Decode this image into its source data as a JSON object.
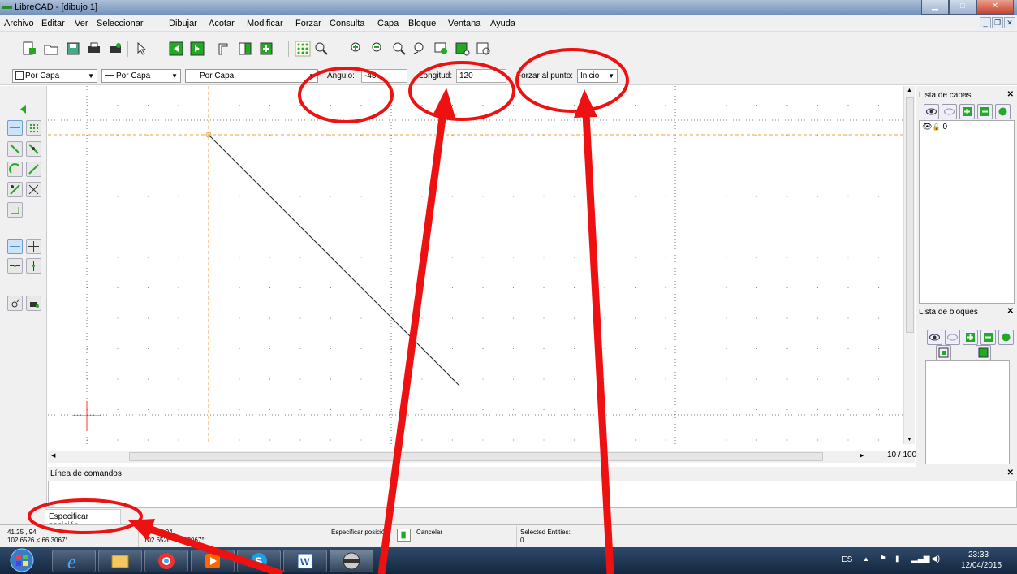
{
  "window": {
    "title": "LibreCAD - [dibujo 1]"
  },
  "menu": [
    "Archivo",
    "Editar",
    "Ver",
    "Seleccionar",
    "Dibujar",
    "Acotar",
    "Modificar",
    "Forzar",
    "Consulta",
    "Capa",
    "Bloque",
    "Ventana",
    "Ayuda"
  ],
  "tool_options": {
    "color_combo": "Por Capa",
    "width_combo": "Por Capa",
    "linetype_combo": "Por Capa",
    "angle_label": "Angulo:",
    "angle_value": "-45",
    "length_label": "Longitud:",
    "length_value": "120",
    "snap_label": "Forzar al punto:",
    "snap_value": "Inicio"
  },
  "canvas": {
    "page_info": "10 / 100"
  },
  "layers_panel": {
    "title": "Lista de capas",
    "layers": [
      {
        "name": "0"
      }
    ]
  },
  "blocks_panel": {
    "title": "Lista de bloques"
  },
  "command_line": {
    "title": "Línea de comandos",
    "tab_label": "Especificar posición"
  },
  "status": {
    "abs_coords": "41.25 , 94",
    "abs_polar": "102.6526 < 66.3067°",
    "rel_coords": "41.25 , 94",
    "rel_polar": "102.6526 < 66.3067°",
    "mouse_left": "Especificar posición",
    "mouse_right": "Cancelar",
    "selected_label": "Selected Entities:",
    "selected_count": "0"
  },
  "taskbar": {
    "language": "ES",
    "time": "23:33",
    "date": "12/04/2015"
  },
  "colors": {
    "grid_guide": "#f0a040",
    "annotation": "#ee1111",
    "cursor": "#ff3030"
  }
}
